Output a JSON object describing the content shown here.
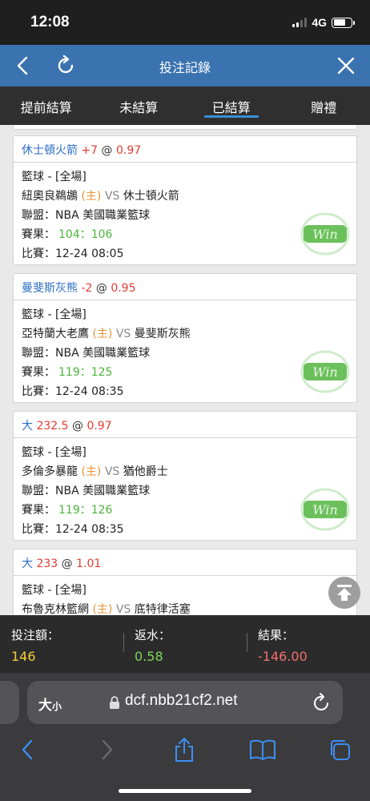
{
  "status_bar": {
    "time": "12:08",
    "network": "4G"
  },
  "header": {
    "title": "投注記錄"
  },
  "tabs": [
    {
      "label": "提前結算",
      "active": false
    },
    {
      "label": "未結算",
      "active": false
    },
    {
      "label": "已結算",
      "active": true
    },
    {
      "label": "贈禮",
      "active": false
    }
  ],
  "bets": [
    {
      "pick": "休士頓火箭",
      "handicap": "+7",
      "at": "@",
      "odds": "0.97",
      "sport": "籃球 - [全場]",
      "home_team": "紐奧良鵜鶘",
      "home_marker": "(主)",
      "vs": "VS",
      "away_team": "休士頓火箭",
      "league_label": "聯盟：",
      "league": "NBA 美國職業籃球",
      "result_label": "賽果：",
      "result": "104：106",
      "match_label": "比賽：",
      "match_time": "12-24 08:05",
      "status": "Win"
    },
    {
      "pick": "曼斐斯灰熊",
      "handicap": "-2",
      "at": "@",
      "odds": "0.95",
      "sport": "籃球 - [全場]",
      "home_team": "亞特蘭大老鷹",
      "home_marker": "(主)",
      "vs": "VS",
      "away_team": "曼斐斯灰熊",
      "league_label": "聯盟：",
      "league": "NBA 美國職業籃球",
      "result_label": "賽果：",
      "result": "119：125",
      "match_label": "比賽：",
      "match_time": "12-24 08:35",
      "status": "Win"
    },
    {
      "pick": "大",
      "handicap": "232.5",
      "at": "@",
      "odds": "0.97",
      "sport": "籃球 - [全場]",
      "home_team": "多倫多暴龍",
      "home_marker": "(主)",
      "vs": "VS",
      "away_team": "猶他爵士",
      "league_label": "聯盟：",
      "league": "NBA 美國職業籃球",
      "result_label": "賽果：",
      "result": "119：126",
      "match_label": "比賽：",
      "match_time": "12-24 08:35",
      "status": "Win"
    },
    {
      "pick": "大",
      "handicap": "233",
      "at": "@",
      "odds": "1.01",
      "sport": "籃球 - [全場]",
      "home_team": "布魯克林籃網",
      "home_marker": "(主)",
      "vs": "VS",
      "away_team": "底特律活塞"
    }
  ],
  "summary": {
    "stake_label": "投注額：",
    "stake": "146",
    "rebate_label": "返水：",
    "rebate": "0.58",
    "result_label": "結果：",
    "result": "-146.00",
    "colors": {
      "stake": "#f2cf3c",
      "rebate": "#7fd65a",
      "result": "#f26f6f"
    }
  },
  "browser": {
    "text_size_label": "大",
    "text_size_small": "小",
    "url": "dcf.nbb21cf2.net"
  },
  "colors": {
    "header": "#3a73b0",
    "win": "#4cb43a",
    "pick": "#2e6fc4",
    "odds": "#e33c32"
  }
}
